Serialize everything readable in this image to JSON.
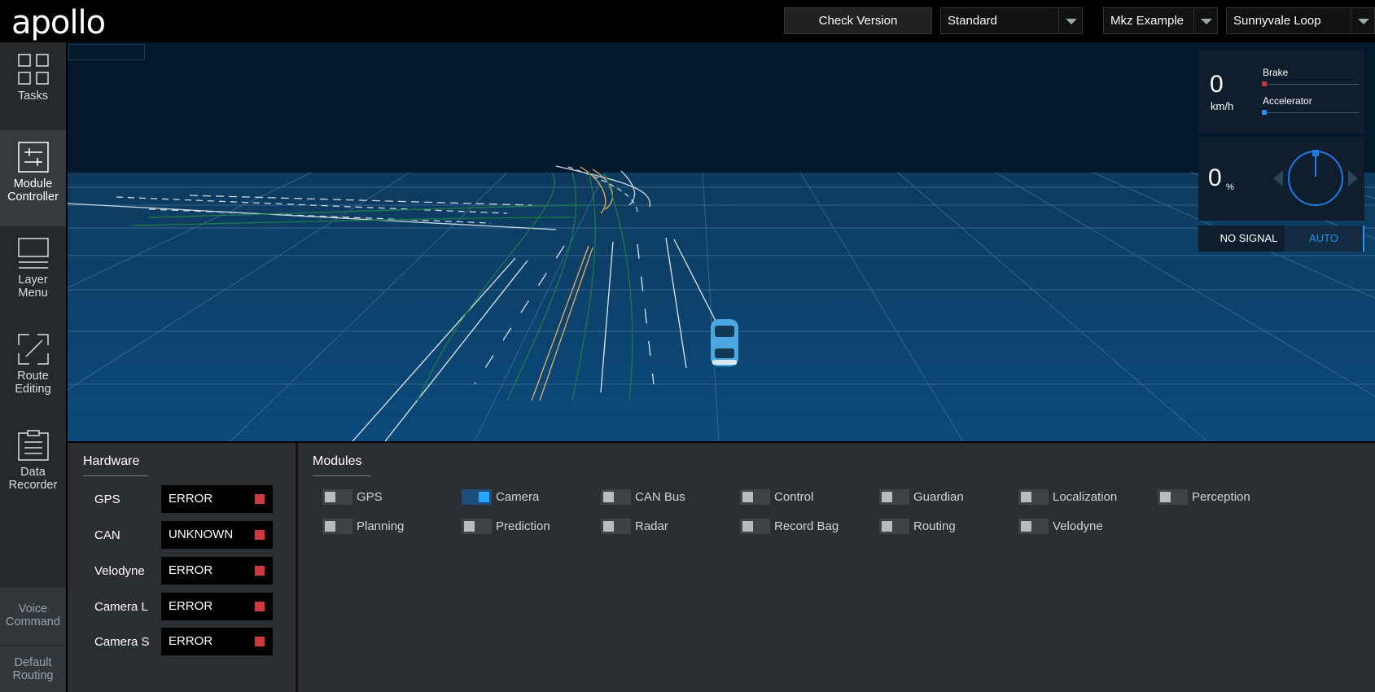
{
  "header": {
    "logo": "apollo",
    "check_version": "Check Version",
    "mode_select": "Standard",
    "vehicle_select": "Mkz Example",
    "map_select": "Sunnyvale Loop"
  },
  "sidebar": {
    "items": [
      {
        "label_line1": "Tasks",
        "label_line2": ""
      },
      {
        "label_line1": "Module",
        "label_line2": "Controller"
      },
      {
        "label_line1": "Layer",
        "label_line2": "Menu"
      },
      {
        "label_line1": "Route",
        "label_line2": "Editing"
      },
      {
        "label_line1": "Data",
        "label_line2": "Recorder"
      }
    ],
    "bottom": [
      {
        "label_line1": "Voice",
        "label_line2": "Command"
      },
      {
        "label_line1": "Default",
        "label_line2": "Routing"
      }
    ]
  },
  "dashboard": {
    "speed": "0",
    "speed_unit": "km/h",
    "brake_label": "Brake",
    "brake_fraction": 0,
    "accelerator_label": "Accelerator",
    "accelerator_fraction": 0,
    "steering": "0",
    "steering_unit": "%",
    "signal": "NO SIGNAL",
    "drive_mode": "AUTO",
    "colors": {
      "brake": "#c0363a",
      "accelerator": "#2b8ef0",
      "wheel": "#1f7ae8"
    }
  },
  "hardware": {
    "title": "Hardware",
    "items": [
      {
        "name": "GPS",
        "status": "ERROR"
      },
      {
        "name": "CAN",
        "status": "UNKNOWN"
      },
      {
        "name": "Velodyne",
        "status": "ERROR"
      },
      {
        "name": "Camera L",
        "status": "ERROR"
      },
      {
        "name": "Camera S",
        "status": "ERROR"
      }
    ],
    "status_color": "#d0393c"
  },
  "modules": {
    "title": "Modules",
    "items": [
      {
        "name": "GPS",
        "on": false
      },
      {
        "name": "Camera",
        "on": true
      },
      {
        "name": "CAN Bus",
        "on": false
      },
      {
        "name": "Control",
        "on": false
      },
      {
        "name": "Guardian",
        "on": false
      },
      {
        "name": "Localization",
        "on": false
      },
      {
        "name": "Perception",
        "on": false
      },
      {
        "name": "Planning",
        "on": false
      },
      {
        "name": "Prediction",
        "on": false
      },
      {
        "name": "Radar",
        "on": false
      },
      {
        "name": "Record Bag",
        "on": false
      },
      {
        "name": "Routing",
        "on": false
      },
      {
        "name": "Velodyne",
        "on": false
      }
    ]
  }
}
